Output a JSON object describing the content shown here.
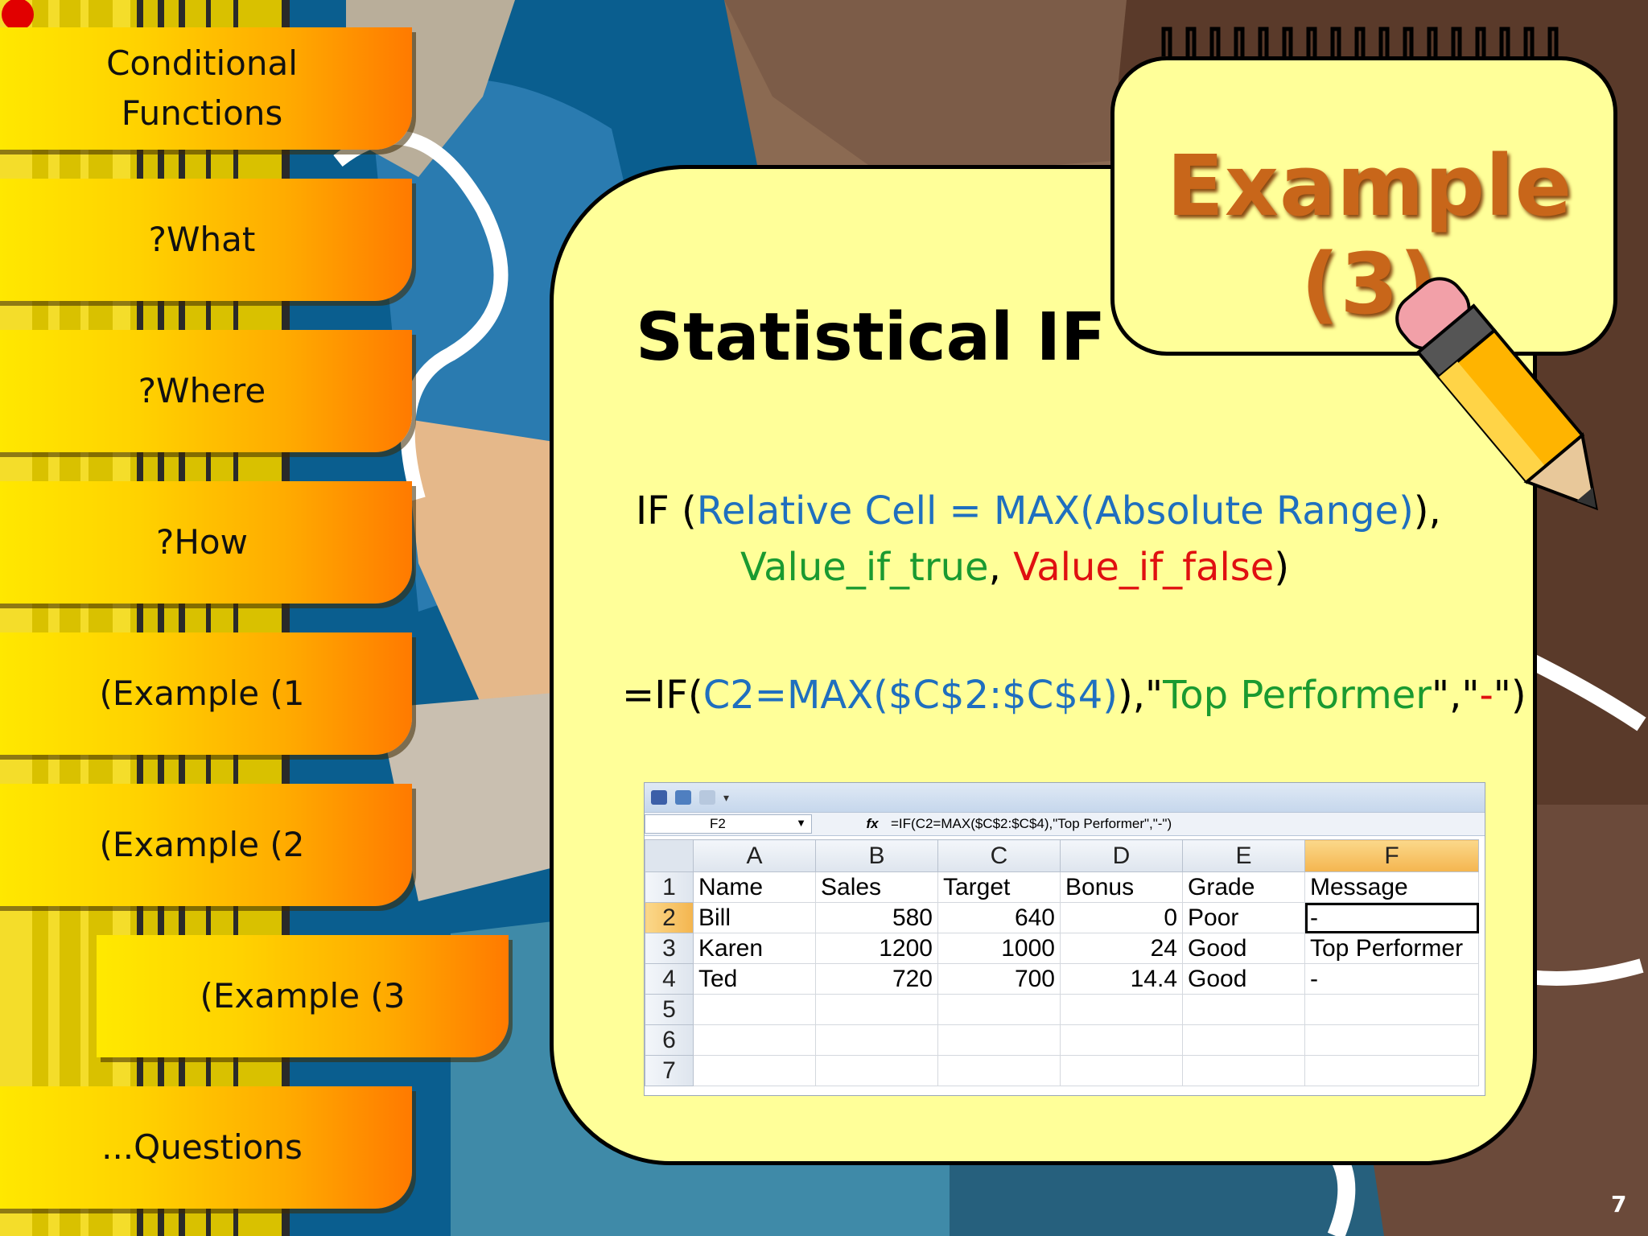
{
  "nav": {
    "items": [
      {
        "label": "Conditional\nFunctions"
      },
      {
        "label": "?What"
      },
      {
        "label": "?Where"
      },
      {
        "label": "?How"
      },
      {
        "label": "(Example (1"
      },
      {
        "label": "(Example (2"
      },
      {
        "label": "(Example (3"
      },
      {
        "label": "...Questions"
      }
    ]
  },
  "slide": {
    "title": "Example (3)",
    "heading": "Statistical IF",
    "syntax": {
      "if_open": "IF (",
      "condition": "Relative Cell = MAX(Absolute Range)",
      "sep1": "),",
      "value_true": "Value_if_true",
      "sep2": ", ",
      "value_false": "Value_if_false",
      "close": ")"
    },
    "formula": {
      "start": "=IF(",
      "condition": "C2=MAX($C$2:$C$4)",
      "mid1": "),\"",
      "true_text": "Top Performer",
      "mid2": "\",\"",
      "false_text": "-",
      "end": "\")"
    },
    "page_number": "7"
  },
  "excel": {
    "name_box": "F2",
    "fx_label": "fx",
    "formula_bar": "=IF(C2=MAX($C$2:$C$4),\"Top Performer\",\"-\")",
    "columns": [
      "A",
      "B",
      "C",
      "D",
      "E",
      "F"
    ],
    "rows": [
      {
        "n": "1",
        "cells": [
          "Name",
          "Sales",
          "Target",
          "Bonus",
          "Grade",
          "Message"
        ]
      },
      {
        "n": "2",
        "cells": [
          "Bill",
          "580",
          "640",
          "0",
          "Poor",
          "-"
        ]
      },
      {
        "n": "3",
        "cells": [
          "Karen",
          "1200",
          "1000",
          "24",
          "Good",
          "Top Performer"
        ]
      },
      {
        "n": "4",
        "cells": [
          "Ted",
          "720",
          "700",
          "14.4",
          "Good",
          "-"
        ]
      },
      {
        "n": "5",
        "cells": [
          "",
          "",
          "",
          "",
          "",
          ""
        ]
      },
      {
        "n": "6",
        "cells": [
          "",
          "",
          "",
          "",
          "",
          ""
        ]
      },
      {
        "n": "7",
        "cells": [
          "",
          "",
          "",
          "",
          "",
          ""
        ]
      }
    ]
  },
  "colors": {
    "card": "#ffff99",
    "title": "#c8661a",
    "blue": "#1f6fbf",
    "green": "#1a9a30",
    "red": "#e01010"
  }
}
